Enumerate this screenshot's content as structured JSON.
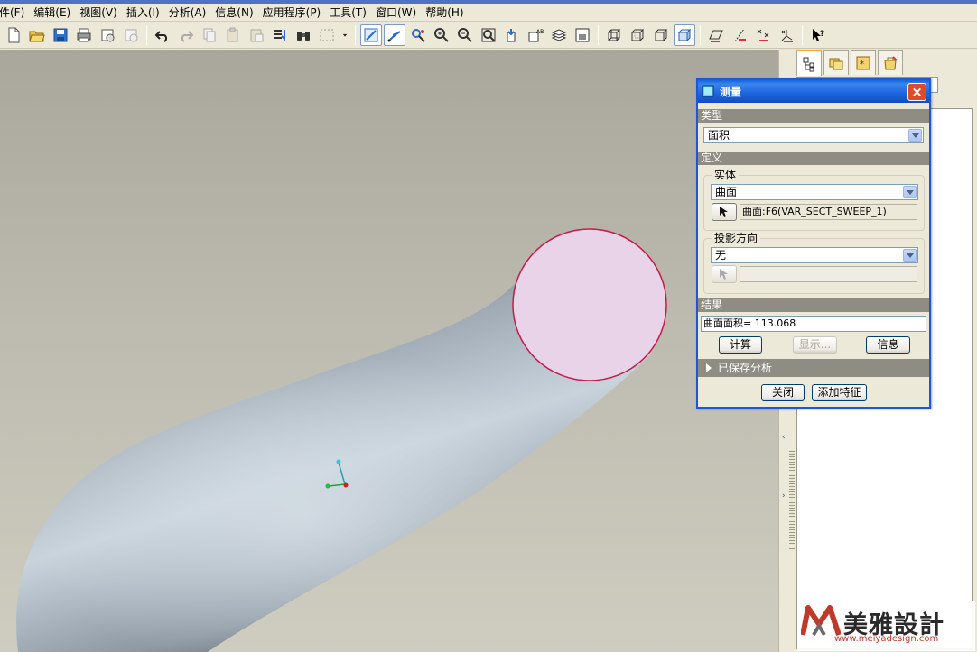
{
  "menubar": {
    "items": [
      {
        "label": "文件(F)",
        "visible": "件(F)"
      },
      {
        "label": "编辑(E)"
      },
      {
        "label": "视图(V)"
      },
      {
        "label": "插入(I)"
      },
      {
        "label": "分析(A)"
      },
      {
        "label": "信息(N)"
      },
      {
        "label": "应用程序(P)"
      },
      {
        "label": "工具(T)"
      },
      {
        "label": "窗口(W)"
      },
      {
        "label": "帮助(H)"
      }
    ]
  },
  "toolbar": {
    "buttons": [
      "new-icon",
      "open-icon",
      "save-icon",
      "print-icon",
      "email-icon",
      "send-icon",
      "undo-icon",
      "redo-icon",
      "copy-icon",
      "paste-icon",
      "paste-special-icon",
      "regenerate-icon",
      "binoculars-icon",
      "select-box-icon",
      "dropdown-arrow-icon",
      "repaint-icon",
      "spin-center-icon",
      "orient-icon",
      "zoom-in-icon",
      "zoom-out-icon",
      "refit-icon",
      "saved-views-icon",
      "annotation-icon",
      "layers-icon",
      "model-display-icon",
      "wireframe-icon",
      "hidden-line-icon",
      "no-hidden-icon",
      "shading-icon",
      "datum-planes-icon",
      "datum-axes-icon",
      "datum-points-icon",
      "csys-icon",
      "whats-this-icon"
    ]
  },
  "dialog": {
    "title": "测量",
    "type_section": "类型",
    "type_value": "面积",
    "define_section": "定义",
    "entity_group": "实体",
    "entity_value": "曲面",
    "entity_reference": "曲面:F6(VAR_SECT_SWEEP_1)",
    "projection_group": "投影方向",
    "projection_value": "无",
    "projection_reference": "",
    "result_section": "结果",
    "result_text": "曲面面积= 113.068",
    "compute_button": "计算",
    "show_button": "显示...",
    "info_button": "信息",
    "saved_analysis": "已保存分析",
    "close_button": "关闭",
    "add_feature_button": "添加特征"
  },
  "watermark": {
    "text": "美雅設計",
    "url": "www.meiyadesign.com"
  },
  "colors": {
    "title_bar": "#1d66df",
    "section_header": "#8e8c83",
    "end_face": "#e8d3e8",
    "end_face_edge": "#c41c4b",
    "pipe": "#98a3ad"
  }
}
